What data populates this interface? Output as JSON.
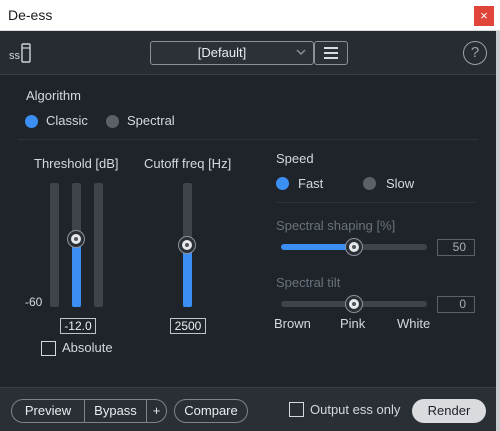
{
  "window": {
    "title": "De-ess",
    "close_label": "×"
  },
  "toolbar": {
    "module_icon_label": "ss",
    "preset": "[Default]",
    "help_label": "?"
  },
  "algorithm": {
    "heading": "Algorithm",
    "options": [
      {
        "label": "Classic",
        "selected": true
      },
      {
        "label": "Spectral",
        "selected": false
      }
    ]
  },
  "threshold": {
    "label": "Threshold [dB]",
    "value": "-12.0",
    "scale_label": "-60"
  },
  "cutoff": {
    "label": "Cutoff freq [Hz]",
    "value": "2500"
  },
  "absolute": {
    "label": "Absolute",
    "checked": false
  },
  "speed": {
    "heading": "Speed",
    "options": [
      {
        "label": "Fast",
        "selected": true
      },
      {
        "label": "Slow",
        "selected": false
      }
    ]
  },
  "spectral_shaping": {
    "label": "Spectral shaping [%]",
    "value": "50"
  },
  "spectral_tilt": {
    "label": "Spectral tilt",
    "value": "0",
    "ticks": [
      "Brown",
      "Pink",
      "White"
    ]
  },
  "bottom": {
    "preview": "Preview",
    "bypass": "Bypass",
    "plus": "+",
    "compare": "Compare",
    "output_ess_only": "Output ess only",
    "render": "Render"
  },
  "colors": {
    "accent": "#3b8ff3",
    "background": "#1f242b",
    "close": "#e0453a"
  },
  "icons": [
    "module-icon",
    "chevron-down-icon",
    "menu-icon",
    "help-icon",
    "close-icon"
  ]
}
